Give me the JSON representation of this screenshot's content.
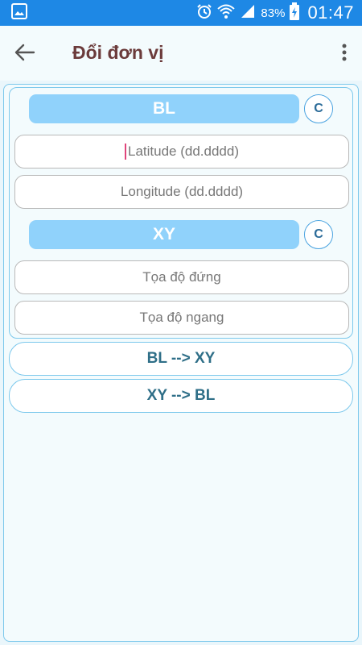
{
  "statusbar": {
    "battery_pct": "83%",
    "time": "01:47"
  },
  "appbar": {
    "title": "Đổi đơn vị"
  },
  "bl_section": {
    "header": "BL",
    "clear_label": "C",
    "latitude_placeholder": "Latitude (dd.dddd)",
    "longitude_placeholder": "Longitude (dd.dddd)"
  },
  "xy_section": {
    "header": "XY",
    "clear_label": "C",
    "vertical_placeholder": "Tọa độ đứng",
    "horizontal_placeholder": "Tọa độ ngang"
  },
  "actions": {
    "bl_to_xy": "BL --> XY",
    "xy_to_bl": "XY --> BL"
  },
  "icons": [
    "image-icon",
    "alarm-icon",
    "wifi-icon",
    "signal-icon",
    "battery-charging-icon",
    "back-arrow-icon",
    "more-vert-icon"
  ],
  "colors": {
    "statusbar": "#1e88e5",
    "header_fill": "#90d2fb",
    "border": "#7cc8ec",
    "title": "#6b3b3b",
    "action_text": "#2f6f88"
  }
}
